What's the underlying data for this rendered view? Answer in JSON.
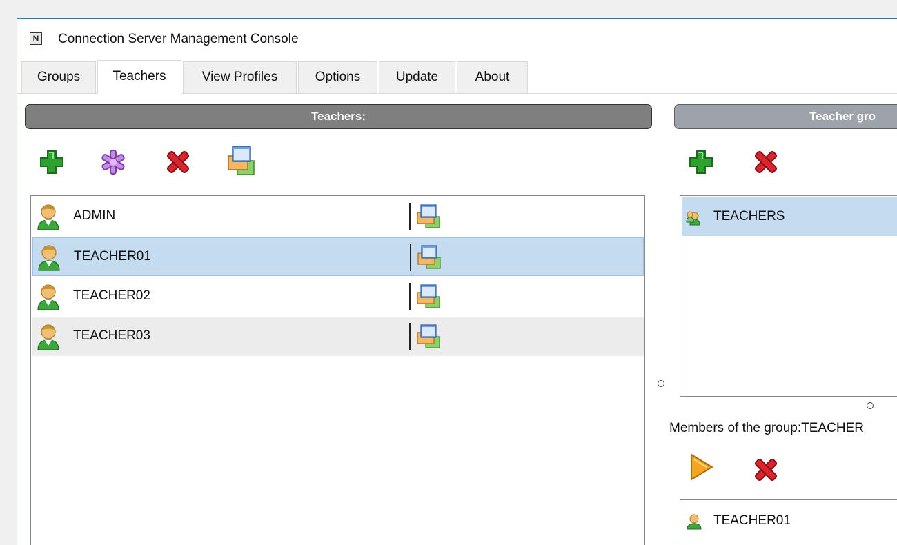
{
  "window": {
    "title": "Connection Server Management Console",
    "app_icon": "N"
  },
  "tabs": [
    {
      "label": "Groups",
      "active": false
    },
    {
      "label": "Teachers",
      "active": true
    },
    {
      "label": "View Profiles",
      "active": false
    },
    {
      "label": "Options",
      "active": false
    },
    {
      "label": "Update",
      "active": false
    },
    {
      "label": "About",
      "active": false
    }
  ],
  "teachers_panel": {
    "header": "Teachers:",
    "toolbar_icons": [
      "add-icon",
      "edit-star-icon",
      "delete-icon",
      "profile-window-icon"
    ],
    "rows": [
      {
        "name": "ADMIN",
        "selected": false
      },
      {
        "name": "TEACHER01",
        "selected": true
      },
      {
        "name": "TEACHER02",
        "selected": false
      },
      {
        "name": "TEACHER03",
        "selected": false
      }
    ]
  },
  "groups_panel": {
    "header": "Teacher gro",
    "toolbar_icons": [
      "add-icon",
      "delete-icon"
    ],
    "groups": [
      {
        "name": "TEACHERS",
        "selected": true
      }
    ],
    "members_label": "Members of the group:TEACHER",
    "members_toolbar_icons": [
      "play-icon",
      "delete-icon"
    ],
    "members": [
      {
        "name": "TEACHER01"
      }
    ]
  },
  "colors": {
    "selection": "#c5dcf0",
    "header_dark": "#7f7f7f",
    "header_light": "#9ea3ab",
    "accent_border": "#2b79c5"
  }
}
